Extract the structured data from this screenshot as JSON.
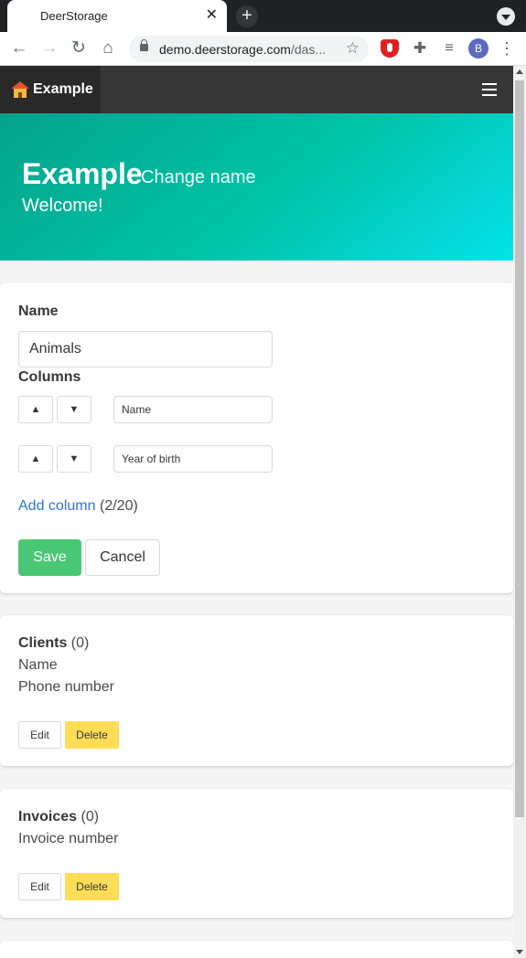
{
  "browser": {
    "tab_title": "DeerStorage",
    "tab_close": "✕",
    "new_tab": "+",
    "url_host": "demo.deerstorage.com",
    "url_path": "/das...",
    "profile_initial": "B"
  },
  "navbar": {
    "brand": "Example"
  },
  "hero": {
    "title": "Example",
    "change_name": "Change name",
    "subtitle": "Welcome!"
  },
  "form": {
    "name_label": "Name",
    "name_value": "Animals",
    "columns_label": "Columns",
    "up_label": "▲",
    "down_label": "▼",
    "columns": [
      {
        "value": "Name"
      },
      {
        "value": "Year of birth"
      }
    ],
    "add_column_label": "Add column",
    "add_column_count": "(2/20)",
    "save_label": "Save",
    "cancel_label": "Cancel"
  },
  "tables": [
    {
      "name": "Clients",
      "count": "(0)",
      "fields": [
        "Name",
        "Phone number"
      ],
      "edit_label": "Edit",
      "delete_label": "Delete"
    },
    {
      "name": "Invoices",
      "count": "(0)",
      "fields": [
        "Invoice number"
      ],
      "edit_label": "Edit",
      "delete_label": "Delete"
    }
  ],
  "colors": {
    "hero_start": "#00c4a7",
    "hero_end": "#00e5e5",
    "save_button": "#48c774",
    "delete_button": "#ffdd57",
    "link": "#3273dc",
    "navbar": "#363636"
  },
  "icons": [
    "back-arrow-icon",
    "forward-arrow-icon",
    "reload-icon",
    "home-icon",
    "lock-icon",
    "star-icon",
    "ublock-icon",
    "puzzle-icon",
    "media-icon",
    "kebab-menu-icon",
    "hamburger-icon",
    "house-logo-icon"
  ]
}
